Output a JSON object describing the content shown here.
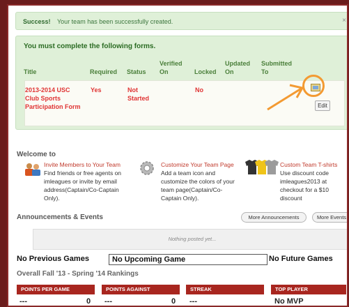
{
  "success": {
    "strong": "Success!",
    "message": "Your team has been successfully created.",
    "close": "×"
  },
  "forms": {
    "heading": "You must complete the following forms.",
    "columns": {
      "title": "Title",
      "required": "Required",
      "status": "Status",
      "verified_on": "Verified On",
      "locked": "Locked",
      "updated_on": "Updated On",
      "submitted_to": "Submitted To"
    },
    "row": {
      "title": "2013-2014 USC Club Sports Participation Form",
      "required": "Yes",
      "status": "Not Started",
      "locked": "No"
    },
    "edit_label": "Edit"
  },
  "welcome": {
    "title": "Welcome to",
    "features": [
      {
        "title": "Invite Members to Your Team",
        "desc": "Find friends or free agents on imleagues or invite by email address(Captain/Co-Captain Only)."
      },
      {
        "title": "Customize Your Team Page",
        "desc": "Add a team icon and customize the colors of your team page(Captain/Co-Captain Only)."
      },
      {
        "title": "Custom Team T-shirts",
        "desc": "Use discount code imleagues2013 at checkout for a $10 discount"
      }
    ]
  },
  "announcements": {
    "title": "Announcements & Events",
    "more_announcements": "More Announcements",
    "more_events": "More Events",
    "empty": "Nothing posted yet..."
  },
  "games": {
    "previous": "No Previous Games",
    "upcoming": "No Upcoming Game",
    "future": "No Future Games"
  },
  "rankings": {
    "title": "Overall Fall '13 - Spring '14 Rankings",
    "headers": [
      "POINTS PER GAME",
      "POINTS AGAINST",
      "STREAK",
      "TOP PLAYER"
    ],
    "values": [
      {
        "dash": "---",
        "num": "0"
      },
      {
        "dash": "---",
        "num": "0"
      },
      {
        "dash": "---",
        "num": ""
      },
      {
        "dash": "No MVP",
        "num": ""
      }
    ]
  },
  "colors": {
    "accent_red": "#a8261f",
    "success_green": "#dff0d8",
    "annotation_orange": "#f39a32"
  }
}
